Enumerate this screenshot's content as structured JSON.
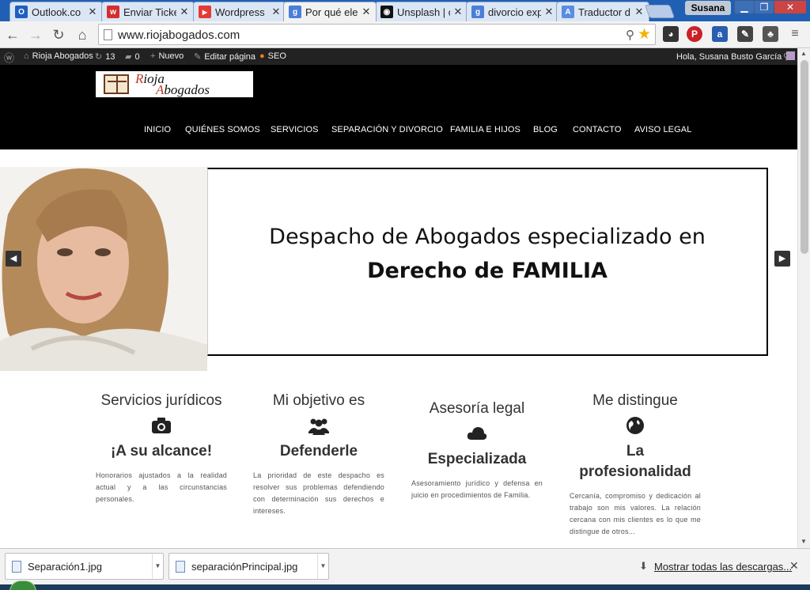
{
  "browser": {
    "tabs": [
      {
        "title": "Outlook.co",
        "favicon_color": "#1f5fbf",
        "favicon_glyph": "O",
        "active": false
      },
      {
        "title": "Enviar Ticke",
        "favicon_color": "#d32f2f",
        "favicon_glyph": "w",
        "active": false
      },
      {
        "title": "Wordpress",
        "favicon_color": "#e53935",
        "favicon_glyph": "▶",
        "active": false
      },
      {
        "title": "Por qué ele",
        "favicon_color": "#4a7fd8",
        "favicon_glyph": "g",
        "active": true
      },
      {
        "title": "Unsplash | c",
        "favicon_color": "#111111",
        "favicon_glyph": "◉",
        "active": false
      },
      {
        "title": "divorcio exp",
        "favicon_color": "#4a7fd8",
        "favicon_glyph": "g",
        "active": false
      },
      {
        "title": "Traductor d",
        "favicon_color": "#5a8de0",
        "favicon_glyph": "A",
        "active": false
      }
    ],
    "profile_name": "Susana",
    "url": "www.riojabogados.com"
  },
  "wp_admin_bar": {
    "site_name": "Rioja Abogados",
    "updates_count": "13",
    "comments_count": "0",
    "new_label": "Nuevo",
    "edit_label": "Editar página",
    "seo_label": "SEO",
    "greeting": "Hola, Susana Busto García"
  },
  "site": {
    "logo_line1": "Rioja",
    "logo_line2": "Abogados",
    "nav": [
      "INICIO",
      "QUIÉNES SOMOS",
      "SERVICIOS",
      "SEPARACIÓN Y DIVORCIO",
      "FAMILIA E HIJOS",
      "BLOG",
      "CONTACTO",
      "AVISO LEGAL"
    ],
    "slide": {
      "line1": "Despacho de Abogados especializado en",
      "line2": "Derecho de FAMILIA"
    },
    "features": [
      {
        "top": "Servicios jurídicos",
        "icon": "camera-icon",
        "heading": "¡A su alcance!",
        "body": "Honorarios ajustados a la realidad actual y a las circunstancias personales."
      },
      {
        "top": "Mi objetivo es",
        "icon": "users-icon",
        "heading": "Defenderle",
        "body": "La prioridad de este despacho es resolver sus problemas defendiendo con determinación sus derechos e intereses."
      },
      {
        "top": "Asesoría legal",
        "icon": "cloud-icon",
        "heading": "Especializada",
        "body": "Asesoramiento jurídico y defensa en juicio en procedimientos de Familia."
      },
      {
        "top": "Me distingue",
        "icon": "globe-icon",
        "heading": "La profesionalidad",
        "body": "Cercanía, compromiso y dedicación al trabajo son mis valores. La relación cercana con mis clientes es lo que me distingue de otros..."
      }
    ]
  },
  "downloads": {
    "items": [
      "Separación1.jpg",
      "separaciónPrincipal.jpg"
    ],
    "show_all": "Mostrar todas las descargas..."
  }
}
